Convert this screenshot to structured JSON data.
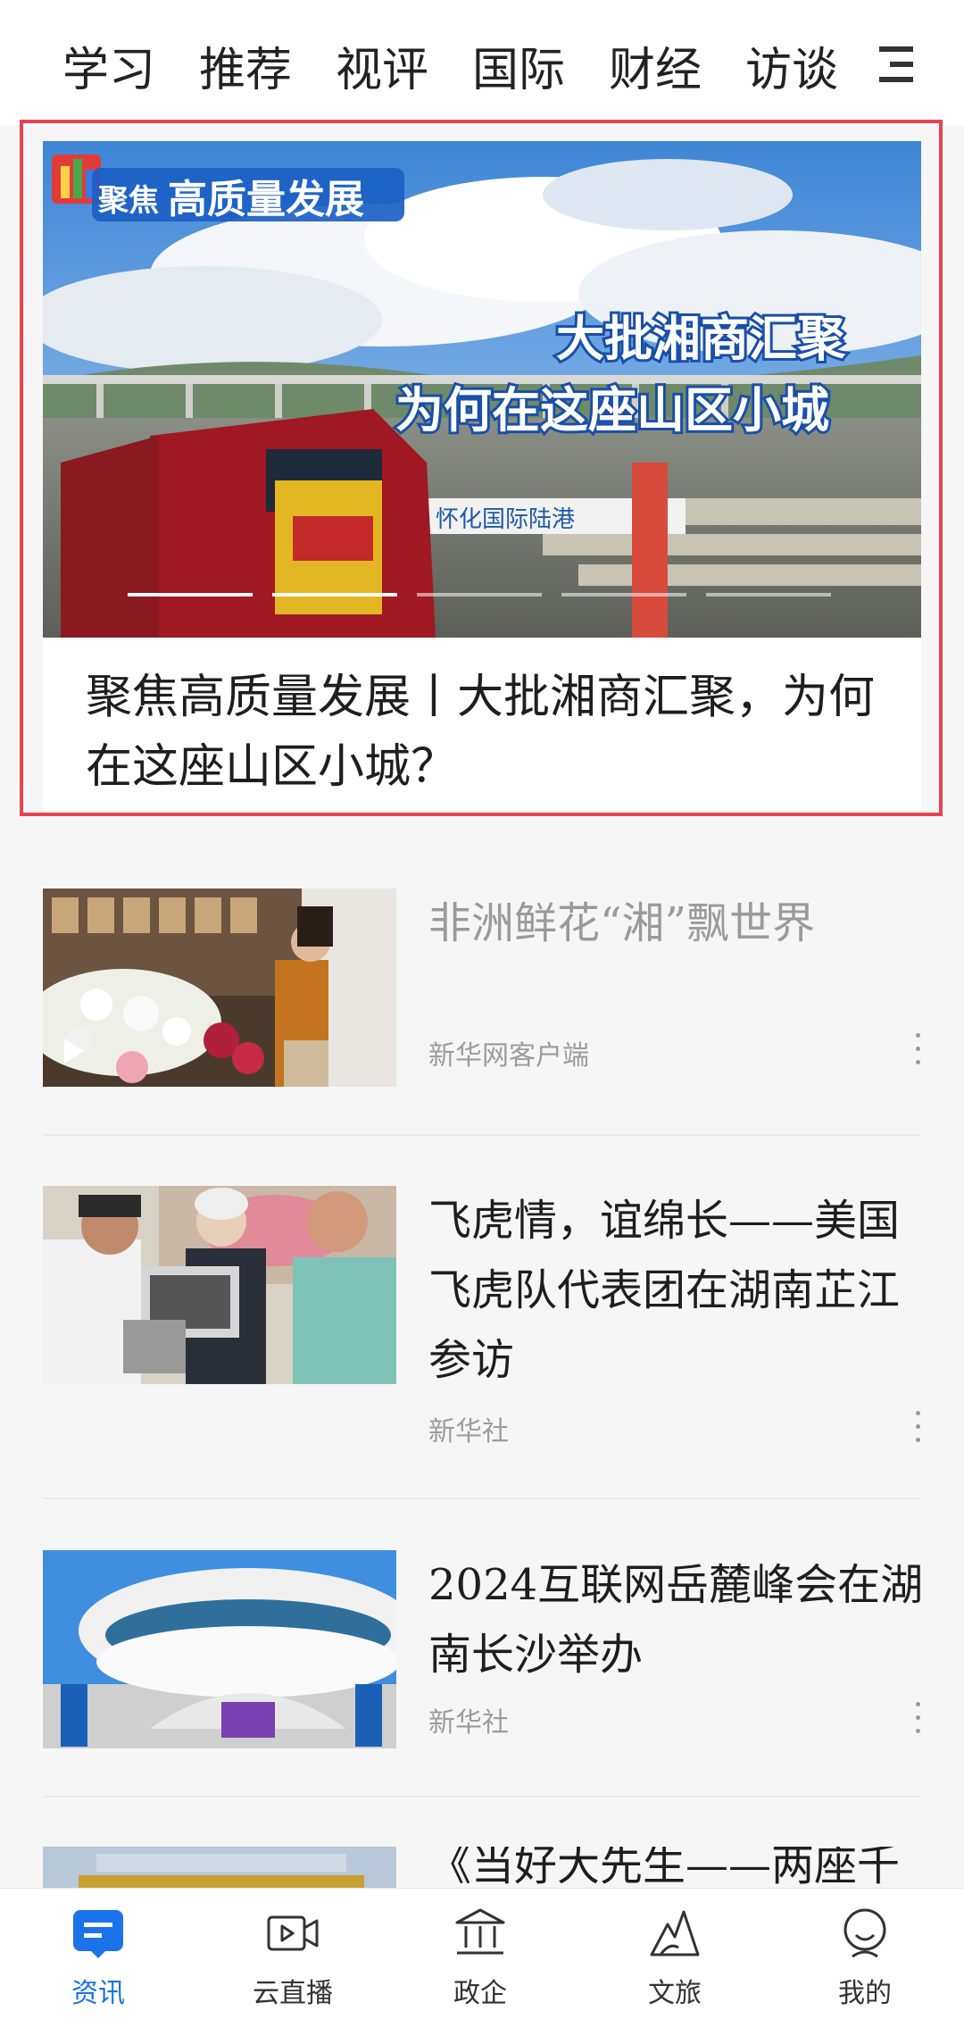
{
  "top_tabs": [
    "学习",
    "推荐",
    "视评",
    "国际",
    "财经",
    "访谈"
  ],
  "featured": {
    "badge_prefix": "聚焦",
    "badge_main": "高质量发展",
    "image_headline_1": "大批湘商汇聚",
    "image_headline_2": "为何在这座山区小城",
    "image_sign": "怀化国际陆港",
    "title": "聚焦高质量发展丨大批湘商汇聚，为何在这座山区小城？"
  },
  "news": [
    {
      "title": "非洲鲜花“湘”飘世界",
      "source": "新华网客户端",
      "read": true,
      "has_video": true
    },
    {
      "title": "飞虎情，谊绵长——美国飞虎队代表团在湖南芷江参访",
      "source": "新华社",
      "read": false,
      "has_video": false
    },
    {
      "title": "2024互联网岳麓峰会在湖南长沙举办",
      "source": "新华社",
      "read": false,
      "has_video": false
    },
    {
      "title": "《当好大先生——两座千",
      "source": "",
      "read": false,
      "has_video": false
    }
  ],
  "bottom_nav": [
    {
      "label": "资讯",
      "icon": "news-icon",
      "active": true
    },
    {
      "label": "云直播",
      "icon": "video-icon",
      "active": false
    },
    {
      "label": "政企",
      "icon": "government-icon",
      "active": false
    },
    {
      "label": "文旅",
      "icon": "mountain-icon",
      "active": false
    },
    {
      "label": "我的",
      "icon": "profile-icon",
      "active": false
    }
  ],
  "colors": {
    "accent": "#1a73e8",
    "highlight_border": "#e8444f"
  }
}
